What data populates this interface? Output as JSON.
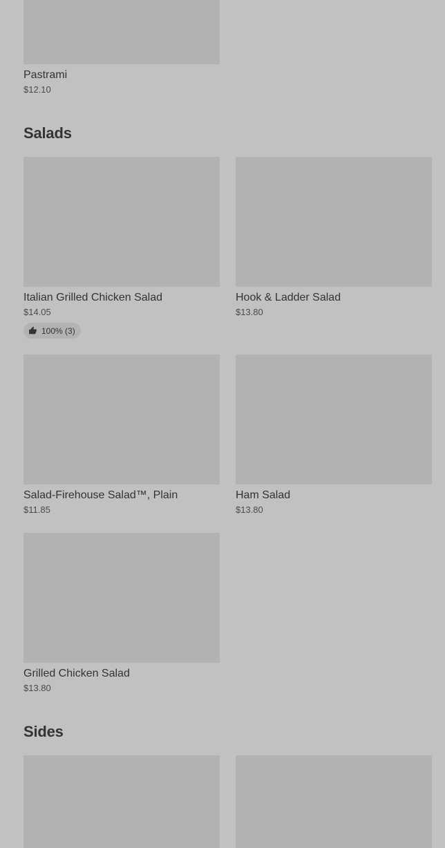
{
  "top_item": {
    "name": "Pastrami",
    "price": "$12.10"
  },
  "sections": {
    "salads": {
      "title": "Salads",
      "items": [
        {
          "name": "Italian Grilled Chicken Salad",
          "price": "$14.05",
          "rating": "100% (3)"
        },
        {
          "name": "Hook & Ladder Salad",
          "price": "$13.80"
        },
        {
          "name": "Salad-Firehouse Salad™, Plain",
          "price": "$11.85"
        },
        {
          "name": "Ham Salad",
          "price": "$13.80"
        },
        {
          "name": "Grilled Chicken Salad",
          "price": "$13.80"
        }
      ]
    },
    "sides": {
      "title": "Sides"
    }
  },
  "icons": {
    "rating": "thumbs-up-icon"
  },
  "colors": {
    "background": "#c1c1c1",
    "thumbnail": "#b2b2b2",
    "text": "#333333"
  }
}
